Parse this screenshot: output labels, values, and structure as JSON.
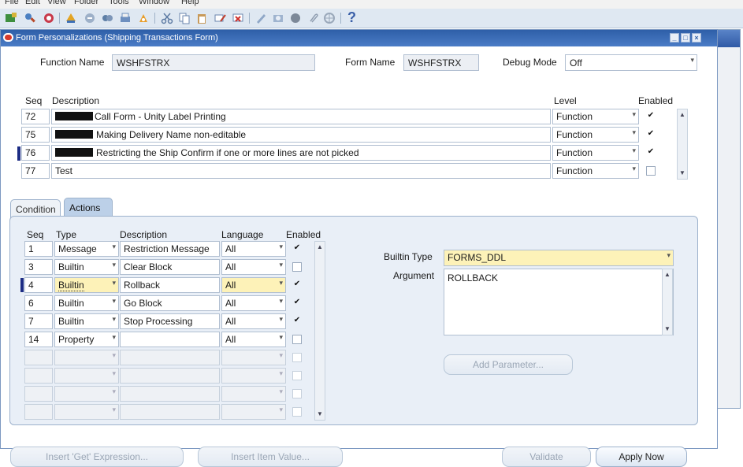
{
  "menubar": [
    "File",
    "Edit",
    "View",
    "Folder",
    "Tools",
    "Window",
    "Help"
  ],
  "toolbar": {
    "help_glyph": "?"
  },
  "window": {
    "title": "Form Personalizations (Shipping Transactions Form)"
  },
  "header": {
    "function_name_label": "Function Name",
    "function_name_value": "WSHFSTRX",
    "form_name_label": "Form Name",
    "form_name_value": "WSHFSTRX",
    "debug_mode_label": "Debug Mode",
    "debug_mode_value": "Off"
  },
  "rules_table": {
    "col_seq": "Seq",
    "col_desc": "Description",
    "col_level": "Level",
    "col_enabled": "Enabled",
    "rows": [
      {
        "seq": "72",
        "desc": "Call Form - Unity Label Printing",
        "level": "Function",
        "enabled": true
      },
      {
        "seq": "75",
        "desc": "Making Delivery Name non-editable",
        "level": "Function",
        "enabled": true
      },
      {
        "seq": "76",
        "desc": "Restricting the Ship Confirm if one or more lines are not picked",
        "level": "Function",
        "enabled": true
      },
      {
        "seq": "77",
        "desc": "Test",
        "level": "Function",
        "enabled": false
      }
    ]
  },
  "tabs": {
    "condition": "Condition",
    "actions": "Actions"
  },
  "actions_table": {
    "col_seq": "Seq",
    "col_type": "Type",
    "col_desc": "Description",
    "col_lang": "Language",
    "col_enabled": "Enabled",
    "rows": [
      {
        "seq": "1",
        "type": "Message",
        "desc": "Restriction Message",
        "lang": "All",
        "enabled": true
      },
      {
        "seq": "3",
        "type": "Builtin",
        "desc": "Clear Block",
        "lang": "All",
        "enabled": false
      },
      {
        "seq": "4",
        "type": "Builtin",
        "desc": "Rollback",
        "lang": "All",
        "enabled": true
      },
      {
        "seq": "6",
        "type": "Builtin",
        "desc": "Go Block",
        "lang": "All",
        "enabled": true
      },
      {
        "seq": "7",
        "type": "Builtin",
        "desc": "Stop Processing",
        "lang": "All",
        "enabled": true
      },
      {
        "seq": "14",
        "type": "Property",
        "desc": "",
        "lang": "All",
        "enabled": false
      }
    ]
  },
  "builtin": {
    "type_label": "Builtin Type",
    "type_value": "FORMS_DDL",
    "argument_label": "Argument",
    "argument_value": "ROLLBACK",
    "add_parameter": "Add Parameter..."
  },
  "buttons": {
    "insert_get": "Insert 'Get' Expression...",
    "insert_item": "Insert Item Value...",
    "validate": "Validate",
    "apply_now": "Apply Now"
  },
  "colors": {
    "title_bar": "#2e5fa8",
    "selected_field": "#fdf2b8",
    "panel": "#e9eff7"
  }
}
